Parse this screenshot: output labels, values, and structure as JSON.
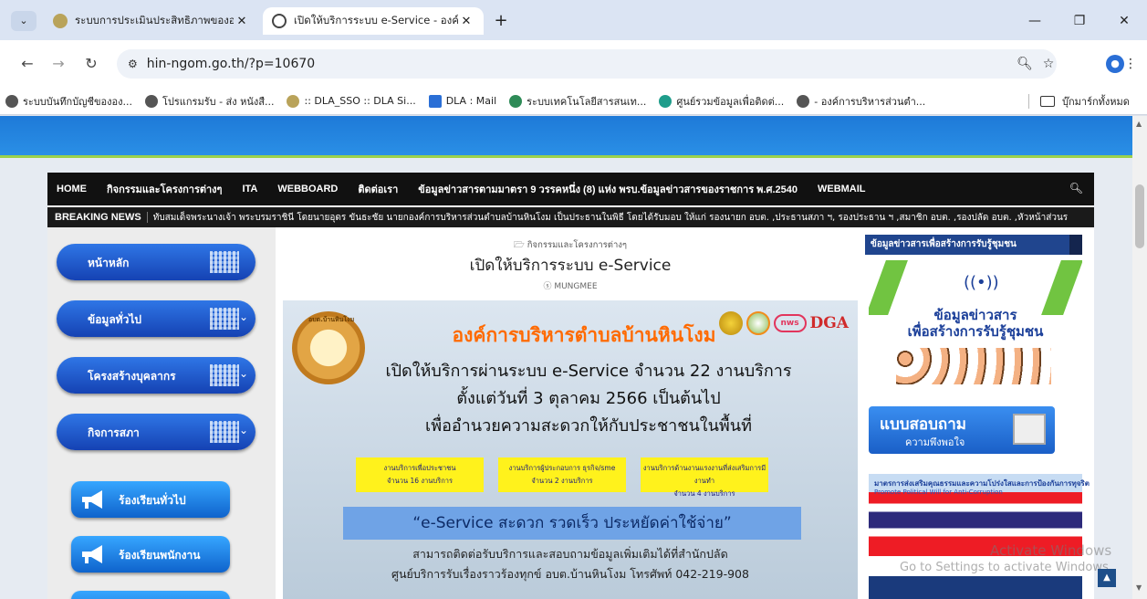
{
  "browser": {
    "tabs": [
      {
        "title": "ระบบการประเมินประสิทธิภาพขององค์",
        "favicon_color": "#b9a35a",
        "active": false
      },
      {
        "title": "เปิดให้บริการระบบ e-Service - องค์ก",
        "favicon_color": "#444444",
        "active": true
      }
    ],
    "tab_close_glyph": "✕",
    "new_tab_glyph": "+",
    "url": "hin-ngom.go.th/?p=10670",
    "bookmarks": [
      {
        "label": "ระบบบันทึกบัญชีขององ...",
        "icon_color": "#555555"
      },
      {
        "label": "โปรแกรมรับ - ส่ง หนังสื...",
        "icon_color": "#555555"
      },
      {
        "label": ":: DLA_SSO :: DLA Si...",
        "icon_color": "#b9a35a"
      },
      {
        "label": "DLA : Mail",
        "icon_color": "#2a6fd6"
      },
      {
        "label": "ระบบเทคโนโลยีสารสนเท...",
        "icon_color": "#2e8b57"
      },
      {
        "label": "ศูนย์รวมข้อมูลเพื่อติดต่...",
        "icon_color": "#1f9d8b"
      },
      {
        "label": "- องค์การบริหารส่วนตำ...",
        "icon_color": "#555555"
      }
    ],
    "all_bookmarks": "บุ๊กมาร์กทั้งหมด"
  },
  "nav": {
    "items": [
      "HOME",
      "กิจกรรมและโครงการต่างๆ",
      "ITA",
      "WEBBOARD",
      "ติดต่อเรา",
      "ข้อมูลข่าวสารตามมาตรา 9 วรรคหนึ่ง (8) แห่ง พรบ.ข้อมูลข่าวสารของราชการ พ.ศ.2540",
      "WEBMAIL"
    ],
    "breaking_label": "BREAKING NEWS",
    "breaking_text": "ทับสมเด็จพระนางเจ้า พระบรมราชินี โดยนายอุดร ขันธะชัย นายกองค์การบริหารส่วนตำบลบ้านหินโงม เป็นประธานในพิธี โดยได้รับมอบ ให้แก่ รองนายก อบต. ,ประธานสภา ฯ, รองประธาน ฯ ,สมาชิก อบต. ,รองปลัด อบต. ,หัวหน้าส่วนร"
  },
  "sidebar": {
    "menu": [
      {
        "label": "หน้าหลัก",
        "has_dropdown": false
      },
      {
        "label": "ข้อมูลทั่วไป",
        "has_dropdown": true
      },
      {
        "label": "โครงสร้างบุคลากร",
        "has_dropdown": true
      },
      {
        "label": "กิจการสภา",
        "has_dropdown": true
      }
    ],
    "complaints": [
      "ร้องเรียนทั่วไป",
      "ร้องเรียนพนักงาน"
    ]
  },
  "post": {
    "category": "กิจกรรมและโครงการต่างๆ",
    "title": "เปิดให้บริการระบบ e-Service",
    "author": "MUNGMEE"
  },
  "banner": {
    "seal_text": "อบต.บ้านหินโงม",
    "org": "องค์การบริหารตำบลบ้านหินโงม",
    "logo_nws": "nws",
    "logo_dga": "DGA",
    "line1": "เปิดให้บริการผ่านระบบ e-Service จำนวน 22 งานบริการ",
    "line2": "ตั้งแต่วันที่ 3 ตุลาคม 2566   เป็นต้นไป",
    "line3": "เพื่ออำนวยความสะดวกให้กับประชาชนในพื้นที่",
    "services": [
      {
        "l1": "งานบริการเพื่อประชาชน",
        "l2": "จำนวน 16 งานบริการ"
      },
      {
        "l1": "งานบริการผู้ประกอบการ ธุรกิจ/sme จำนวน 2 งานบริการ",
        "l2": ""
      },
      {
        "l1": "งานบริการด้านงานแรงงานที่ส่งเสริมการมีงานทำ",
        "l2": "จำนวน 4 งานบริการ"
      }
    ],
    "slogan": "“e-Service สะดวก รวดเร็ว ประหยัดค่าใช้จ่าย”",
    "contact1": "สามารถติดต่อรับบริการและสอบถามข้อมูลเพิ่มเติมได้ที่สำนักปลัด",
    "contact2": "ศูนย์บริการรับเรื่องราวร้องทุกข์ อบต.บ้านหินโงม โทรศัพท์ 042-219-908"
  },
  "right": {
    "header": "ข้อมูลข่าวสารเพื่อสร้างการรับรู้ชุมชน",
    "info_t1": "ข้อมูลข่าวสาร",
    "info_t2": "เพื่อสร้างการรับรู้ชุมชน",
    "survey_t1": "แบบสอบถาม",
    "survey_t2": "ความพึงพอใจ",
    "anti_t1": "มาตรการส่งเสริมคุณธรรมและความโปร่งใสและการป้องกันการทุจริต",
    "anti_t2": "Promote Political Will for Anti-Corruption"
  },
  "os": {
    "activate_1": "Activate Windows",
    "activate_2": "Go to Settings to activate Windows."
  },
  "colors": {
    "nav_bg": "#111111",
    "accent_blue": "#1e7ad8",
    "accent_green": "#9bd14b",
    "banner_orange": "#ff6a00"
  }
}
